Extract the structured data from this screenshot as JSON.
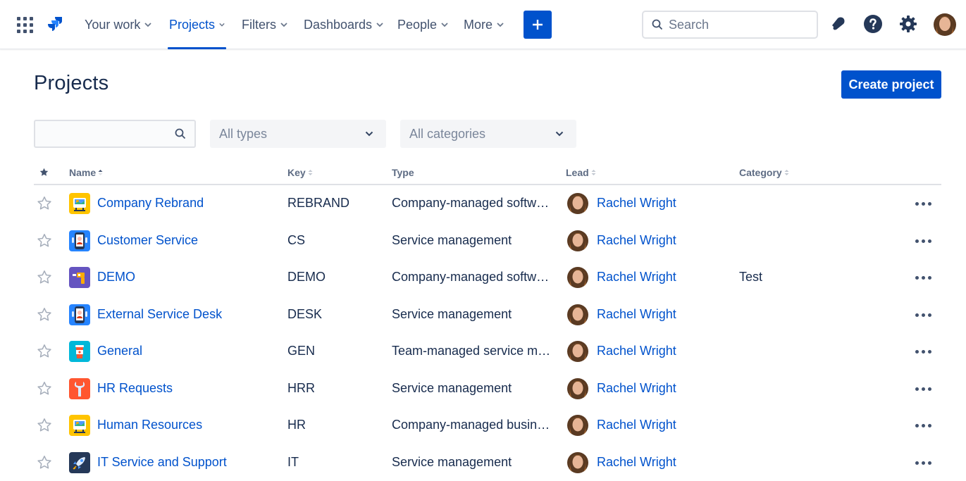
{
  "nav": {
    "items": [
      {
        "label": "Your work",
        "active": false
      },
      {
        "label": "Projects",
        "active": true
      },
      {
        "label": "Filters",
        "active": false
      },
      {
        "label": "Dashboards",
        "active": false
      },
      {
        "label": "People",
        "active": false
      },
      {
        "label": "More",
        "active": false
      }
    ],
    "search_placeholder": "Search"
  },
  "page": {
    "title": "Projects",
    "create_label": "Create project"
  },
  "filters": {
    "search_value": "",
    "type_value": "All types",
    "category_value": "All categories"
  },
  "table": {
    "columns": {
      "name": "Name",
      "key": "Key",
      "type": "Type",
      "lead": "Lead",
      "category": "Category"
    },
    "rows": [
      {
        "name": "Company Rebrand",
        "key": "REBRAND",
        "type": "Company-managed software",
        "lead": "Rachel Wright",
        "category": "",
        "icon": "rebrand-icon"
      },
      {
        "name": "Customer Service",
        "key": "CS",
        "type": "Service management",
        "lead": "Rachel Wright",
        "category": "",
        "icon": "phone-agent-icon"
      },
      {
        "name": "DEMO",
        "key": "DEMO",
        "type": "Company-managed software",
        "lead": "Rachel Wright",
        "category": "Test",
        "icon": "drill-icon"
      },
      {
        "name": "External Service Desk",
        "key": "DESK",
        "type": "Service management",
        "lead": "Rachel Wright",
        "category": "",
        "icon": "phone-agent-icon"
      },
      {
        "name": "General",
        "key": "GEN",
        "type": "Team-managed service ma...",
        "lead": "Rachel Wright",
        "category": "",
        "icon": "coffee-icon"
      },
      {
        "name": "HR Requests",
        "key": "HRR",
        "type": "Service management",
        "lead": "Rachel Wright",
        "category": "",
        "icon": "wrench-icon"
      },
      {
        "name": "Human Resources",
        "key": "HR",
        "type": "Company-managed business",
        "lead": "Rachel Wright",
        "category": "",
        "icon": "rebrand-icon"
      },
      {
        "name": "IT Service and Support",
        "key": "IT",
        "type": "Service management",
        "lead": "Rachel Wright",
        "category": "",
        "icon": "rocket-icon"
      }
    ]
  },
  "colors": {
    "brand": "#0052cc",
    "text": "#172b4d",
    "subtle": "#42526e"
  }
}
